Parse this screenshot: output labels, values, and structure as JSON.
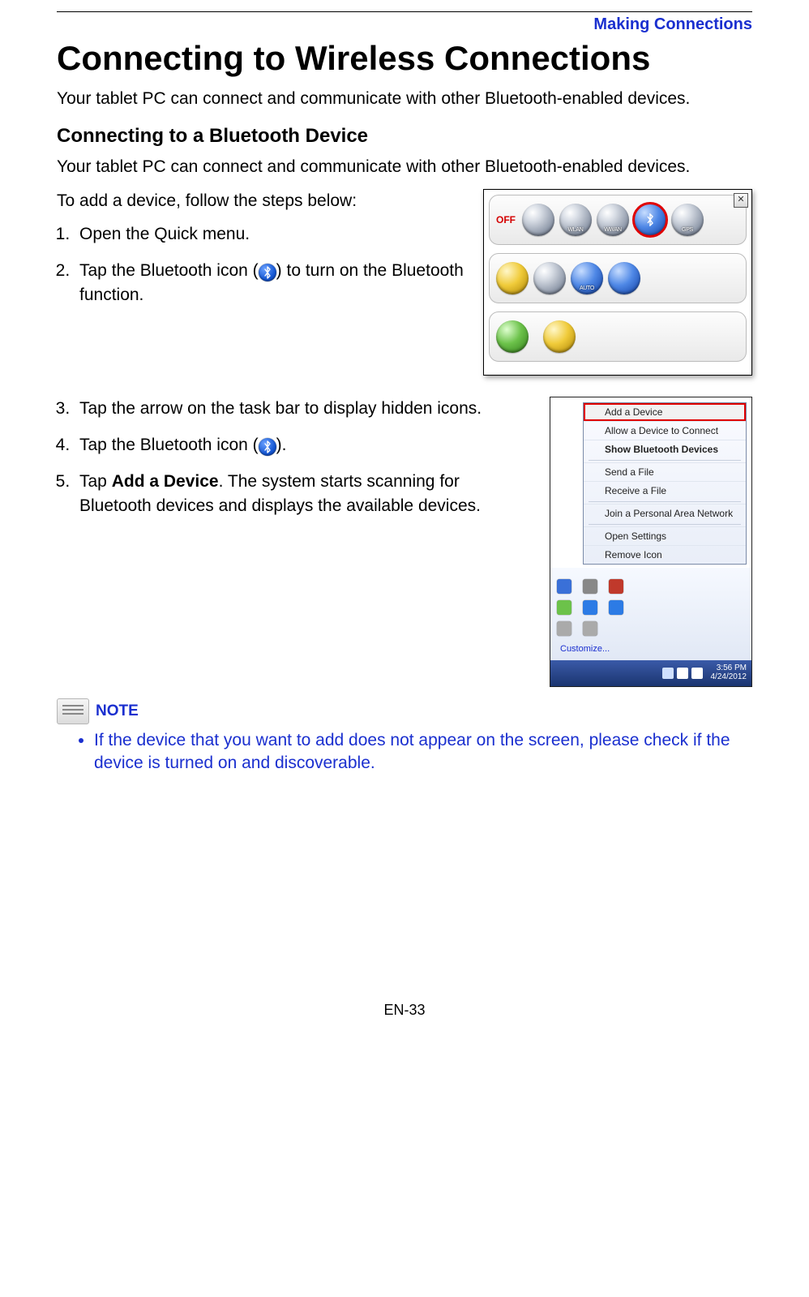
{
  "header": {
    "section_label": "Making Connections",
    "title": "Connecting to Wireless Connections",
    "intro": "Your tablet PC can connect and communicate with other Bluetooth-enabled devices."
  },
  "section2": {
    "heading": "Connecting to a Bluetooth Device",
    "intro": "Your tablet PC can connect and communicate with other Bluetooth-enabled devices.",
    "lead": "To add a device, follow the steps below:",
    "step1": "Open the Quick menu.",
    "step2_a": "Tap the Bluetooth icon (",
    "step2_b": ") to turn on the Bluetooth function."
  },
  "section3": {
    "step3": "Tap the arrow on the task bar to display hidden icons.",
    "step4_a": "Tap the Bluetooth icon (",
    "step4_b": ").",
    "step5_a": "Tap ",
    "step5_bold": "Add a Device",
    "step5_b": ". The system starts scanning for Bluetooth devices and displays the available devices."
  },
  "quickmenu": {
    "off_label": "OFF",
    "row1_icons": [
      "airplane",
      "WLAN",
      "WWAN",
      "bluetooth",
      "GPS"
    ],
    "row2_icons": [
      "brightness",
      "devices",
      "AUTO",
      "rotate"
    ],
    "row3_icons": [
      "tools",
      "info"
    ]
  },
  "contextmenu": {
    "items": [
      {
        "label": "Add a Device",
        "highlight": true
      },
      {
        "label": "Allow a Device to Connect"
      },
      {
        "label": "Show Bluetooth Devices",
        "bold": true
      },
      {
        "label": "Send a File"
      },
      {
        "label": "Receive a File"
      },
      {
        "label": "Join a Personal Area Network"
      },
      {
        "label": "Open Settings"
      },
      {
        "label": "Remove Icon"
      }
    ],
    "customize": "Customize...",
    "clock_time": "3:56 PM",
    "clock_date": "4/24/2012"
  },
  "note": {
    "label": "NOTE",
    "item": "If the device that you want to add does not appear on the screen, please check if the device is turned on and discoverable."
  },
  "footer": {
    "page": "EN-33"
  }
}
